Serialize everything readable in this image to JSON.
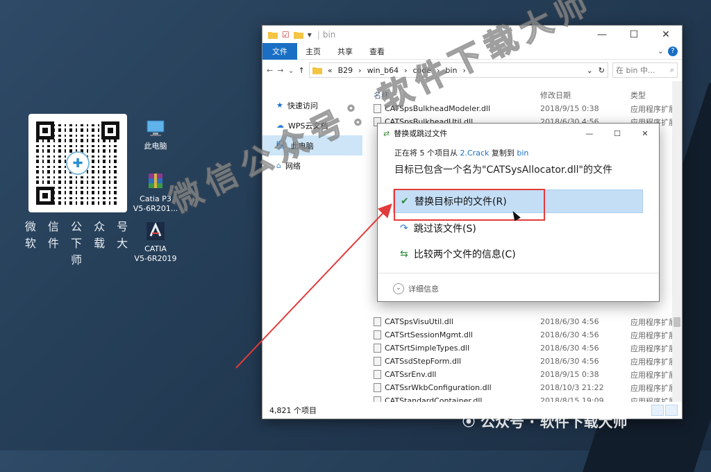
{
  "desktop": {
    "qr_caption_line1": "微 信 公 众 号",
    "qr_caption_line2": "软 件 下 载 大 师",
    "icons": [
      {
        "label": "此电脑",
        "icon": "computer-icon"
      },
      {
        "label": "Catia P3\nV5-6R201...",
        "icon": "winrar-icon"
      },
      {
        "label": "CATIA\nV5-6R2019",
        "icon": "catia-icon"
      }
    ]
  },
  "watermark": {
    "big_text": "微信公众号：软件下载大师",
    "bottom_text": "公众号 · 软件下载大师"
  },
  "explorer": {
    "title": "bin",
    "ribbon": {
      "file": "文件",
      "tabs": [
        "主页",
        "共享",
        "查看"
      ]
    },
    "address": {
      "prefix": "«",
      "path": [
        "B29",
        "win_b64",
        "code",
        "bin"
      ]
    },
    "search_placeholder": "在 bin 中...",
    "nav": [
      {
        "label": "快速访问",
        "icon": "star-icon"
      },
      {
        "label": "WPS云文档",
        "icon": "cloud-icon"
      },
      {
        "label": "此电脑",
        "icon": "computer-icon",
        "selected": true
      },
      {
        "label": "网络",
        "icon": "network-icon"
      }
    ],
    "columns": {
      "name": "名称",
      "date": "修改日期",
      "type": "类型"
    },
    "files_top": [
      {
        "name": "CATSpsBulkheadModeler.dll",
        "date": "2018/9/15 0:38",
        "type": "应用程序扩展"
      },
      {
        "name": "CATSpsBulkheadUtil.dll",
        "date": "2018/6/30 4:56",
        "type": "应用程序扩展"
      }
    ],
    "files_bottom": [
      {
        "name": "CATSpsVisuUtil.dll",
        "date": "2018/6/30 4:56",
        "type": "应用程序扩展"
      },
      {
        "name": "CATSrtSessionMgmt.dll",
        "date": "2018/6/30 4:56",
        "type": "应用程序扩展"
      },
      {
        "name": "CATSrtSimpleTypes.dll",
        "date": "2018/6/30 4:56",
        "type": "应用程序扩展"
      },
      {
        "name": "CATSsdStepForm.dll",
        "date": "2018/6/30 4:56",
        "type": "应用程序扩展"
      },
      {
        "name": "CATSsrEnv.dll",
        "date": "2018/9/15 0:38",
        "type": "应用程序扩展"
      },
      {
        "name": "CATSsrWkbConfiguration.dll",
        "date": "2018/10/3 21:22",
        "type": "应用程序扩展"
      },
      {
        "name": "CATStandardContainer.dll",
        "date": "2018/8/15 19:09",
        "type": "应用程序扩展"
      }
    ],
    "status": "4,821 个项目"
  },
  "dialog": {
    "title": "替换或跳过文件",
    "progress_prefix": "正在将 5 个项目从",
    "progress_source": "2.Crack",
    "progress_middle": "复制到",
    "progress_dest": "bin",
    "heading": "目标已包含一个名为\"CATSysAllocator.dll\"的文件",
    "options": [
      {
        "label": "替换目标中的文件(R)",
        "icon": "check-icon"
      },
      {
        "label": "跳过该文件(S)",
        "icon": "skip-icon"
      },
      {
        "label": "比较两个文件的信息(C)",
        "icon": "compare-icon"
      }
    ],
    "details": "详细信息"
  },
  "colors": {
    "accent": "#1a6fc4",
    "highlight": "#e23b3b",
    "selection": "#c4def6"
  }
}
